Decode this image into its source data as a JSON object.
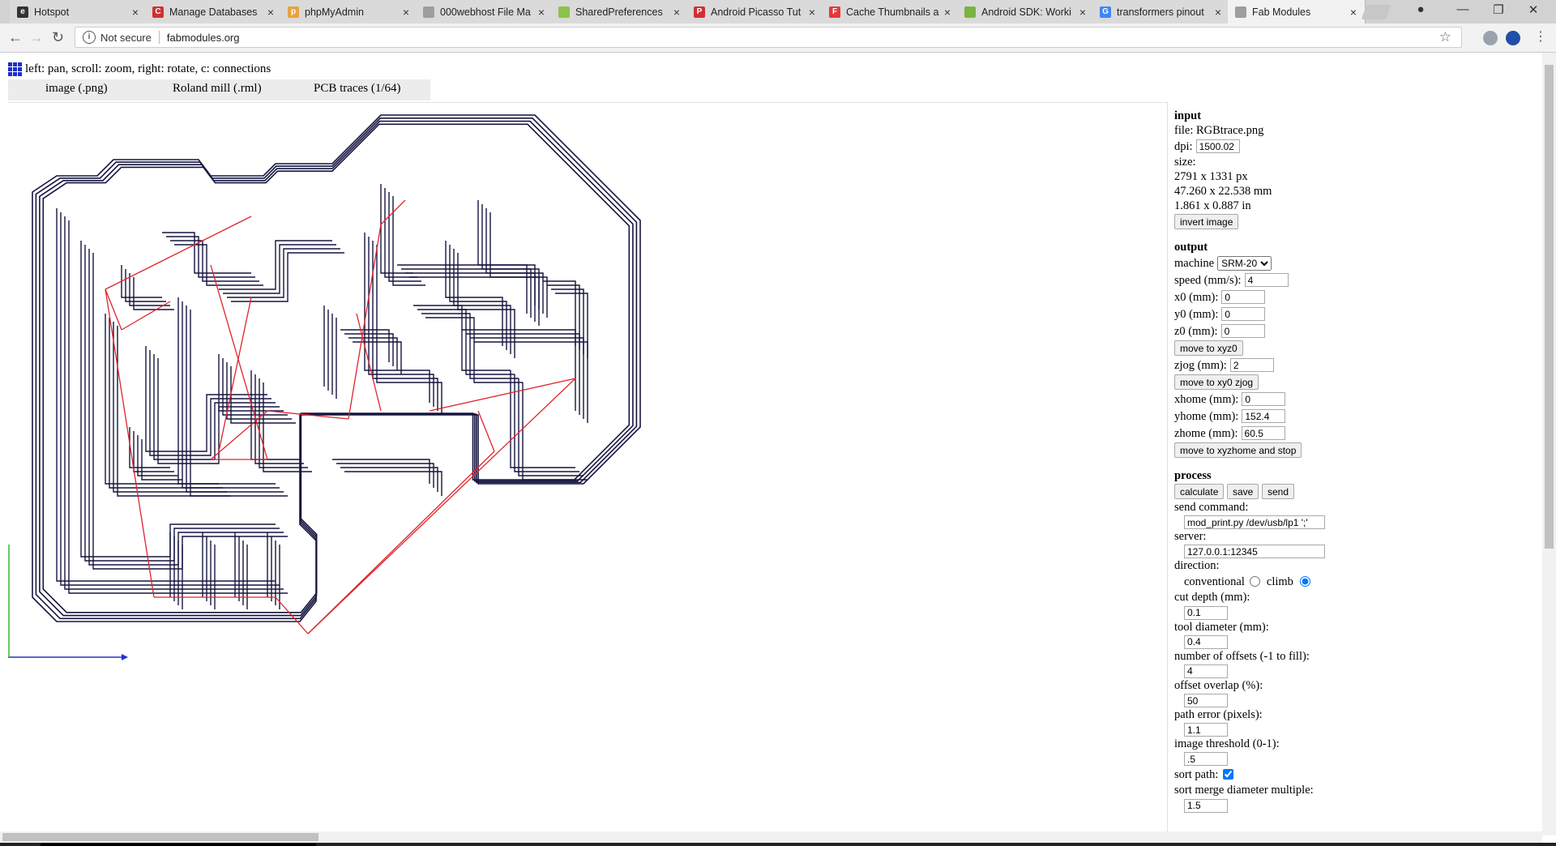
{
  "browser": {
    "tabs": [
      {
        "title": "Hotspot",
        "fav_color": "#333333",
        "fav_glyph": "e"
      },
      {
        "title": "Manage Databases",
        "fav_color": "#cc3333",
        "fav_glyph": "C"
      },
      {
        "title": "phpMyAdmin",
        "fav_color": "#e8a33d",
        "fav_glyph": "p"
      },
      {
        "title": "000webhost File Ma",
        "fav_color": "#9e9e9e",
        "fav_glyph": ""
      },
      {
        "title": "SharedPreferences",
        "fav_color": "#8bc34a",
        "fav_glyph": ""
      },
      {
        "title": "Android Picasso Tut",
        "fav_color": "#d32f2f",
        "fav_glyph": "P"
      },
      {
        "title": "Cache Thumbnails a",
        "fav_color": "#e53935",
        "fav_glyph": "F"
      },
      {
        "title": "Android SDK: Worki",
        "fav_color": "#7cb342",
        "fav_glyph": ""
      },
      {
        "title": "transformers pinout",
        "fav_color": "#4285f4",
        "fav_glyph": "G"
      },
      {
        "title": "Fab Modules",
        "fav_color": "#9e9e9e",
        "fav_glyph": ""
      }
    ],
    "active_tab": 9,
    "security_text": "Not secure",
    "url": "fabmodules.org"
  },
  "page": {
    "help": "left: pan, scroll: zoom, right: rotate, c: connections",
    "tabs": [
      "image (.png)",
      "Roland mill (.rml)",
      "PCB traces (1/64)"
    ]
  },
  "panel": {
    "input": {
      "heading": "input",
      "file": "file: RGBtrace.png",
      "dpi_label": "dpi:",
      "dpi_value": "1500.02",
      "size_label": "size:",
      "size_px": "2791 x 1331 px",
      "size_mm": "47.260 x 22.538 mm",
      "size_in": "1.861 x 0.887 in",
      "invert_button": "invert image"
    },
    "output": {
      "heading": "output",
      "machine_label": "machine",
      "machine_value": "SRM-20",
      "speed_label": "speed (mm/s):",
      "speed_value": "4",
      "x0_label": "x0 (mm):",
      "x0_value": "0",
      "y0_label": "y0 (mm):",
      "y0_value": "0",
      "z0_label": "z0 (mm):",
      "z0_value": "0",
      "move_xyz0_button": "move to xyz0",
      "zjog_label": "zjog (mm):",
      "zjog_value": "2",
      "move_xy0_button": "move to xy0 zjog",
      "xhome_label": "xhome (mm):",
      "xhome_value": "0",
      "yhome_label": "yhome (mm):",
      "yhome_value": "152.4",
      "zhome_label": "zhome (mm):",
      "zhome_value": "60.5",
      "move_home_button": "move to xyzhome and stop"
    },
    "process": {
      "heading": "process",
      "calculate_button": "calculate",
      "save_button": "save",
      "send_button": "send",
      "send_command_label": "send command:",
      "send_command_value": "mod_print.py /dev/usb/lp1 ';'",
      "server_label": "server:",
      "server_value": "127.0.0.1:12345",
      "direction_label": "direction:",
      "conventional_label": "conventional",
      "climb_label": "climb",
      "cut_depth_label": "cut depth (mm):",
      "cut_depth_value": "0.1",
      "tool_diameter_label": "tool diameter (mm):",
      "tool_diameter_value": "0.4",
      "offsets_label": "number of offsets (-1 to fill):",
      "offsets_value": "4",
      "overlap_label": "offset overlap (%):",
      "overlap_value": "50",
      "path_error_label": "path error (pixels):",
      "path_error_value": "1.1",
      "threshold_label": "image threshold (0-1):",
      "threshold_value": ".5",
      "sort_path_label": "sort path:",
      "merge_label": "sort merge diameter multiple:",
      "merge_value": "1.5"
    }
  },
  "colors": {
    "trace": "#15153f",
    "move": "#e0242b",
    "axis_x": "#2233cc",
    "axis_y": "#33bb33"
  }
}
